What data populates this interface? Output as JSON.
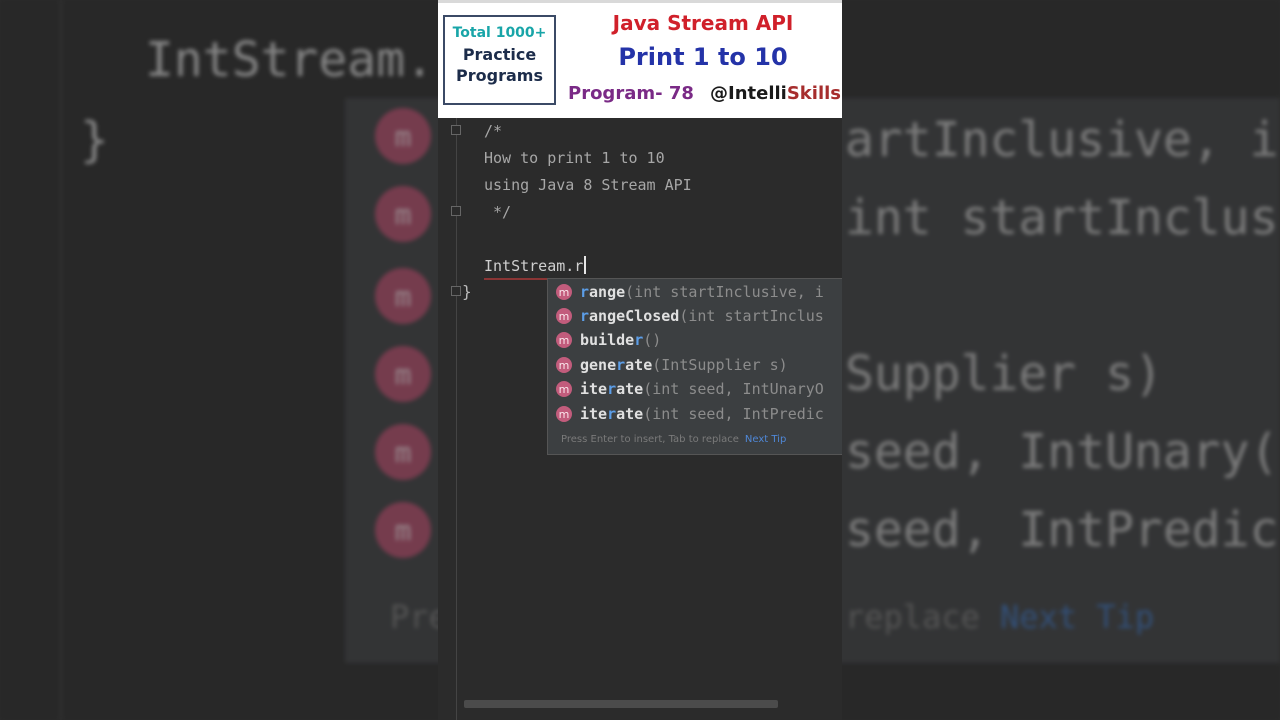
{
  "background": {
    "code_text": "IntStream.",
    "brace": "}",
    "right_lines": [
      "artInclusive, i",
      "int startInclus",
      "",
      "Supplier s)",
      "seed, IntUnary(",
      "seed, IntPredic"
    ],
    "hint_left": "Pre",
    "hint_right": "replace",
    "tip": "Next Tip"
  },
  "banner": {
    "box_line1": "Total 1000+",
    "box_line2": "Practice",
    "box_line3": "Programs",
    "title1": "Java Stream API",
    "title2": "Print 1 to 10",
    "program": "Program- 78",
    "handle_prefix": "@Intelli",
    "handle_suffix": "Skills"
  },
  "code": {
    "comment_open": "/*",
    "comment_line1": "How to print 1 to 10",
    "comment_line2": "using Java 8 Stream API",
    "comment_close": " */",
    "statement": "IntStream.r",
    "close_brace": "}"
  },
  "completion": {
    "icon_letter": "m",
    "items": [
      {
        "name_pre": "",
        "name_hl": "r",
        "name_post": "ange",
        "sig": "(int startInclusive, i"
      },
      {
        "name_pre": "",
        "name_hl": "r",
        "name_post": "angeClosed",
        "sig": "(int startInclus"
      },
      {
        "name_pre": "builde",
        "name_hl": "r",
        "name_post": "",
        "sig": "()"
      },
      {
        "name_pre": "gene",
        "name_hl": "r",
        "name_post": "ate",
        "sig": "(IntSupplier s)"
      },
      {
        "name_pre": "ite",
        "name_hl": "r",
        "name_post": "ate",
        "sig": "(int seed, IntUnaryO"
      },
      {
        "name_pre": "ite",
        "name_hl": "r",
        "name_post": "ate",
        "sig": "(int seed, IntPredic"
      }
    ],
    "hint": "Press Enter to insert, Tab to replace",
    "tip": "Next Tip"
  },
  "colors": {
    "method_icon": "#c25c7c",
    "match_highlight": "#5c9ee8",
    "tip_link": "#4f87d6"
  }
}
